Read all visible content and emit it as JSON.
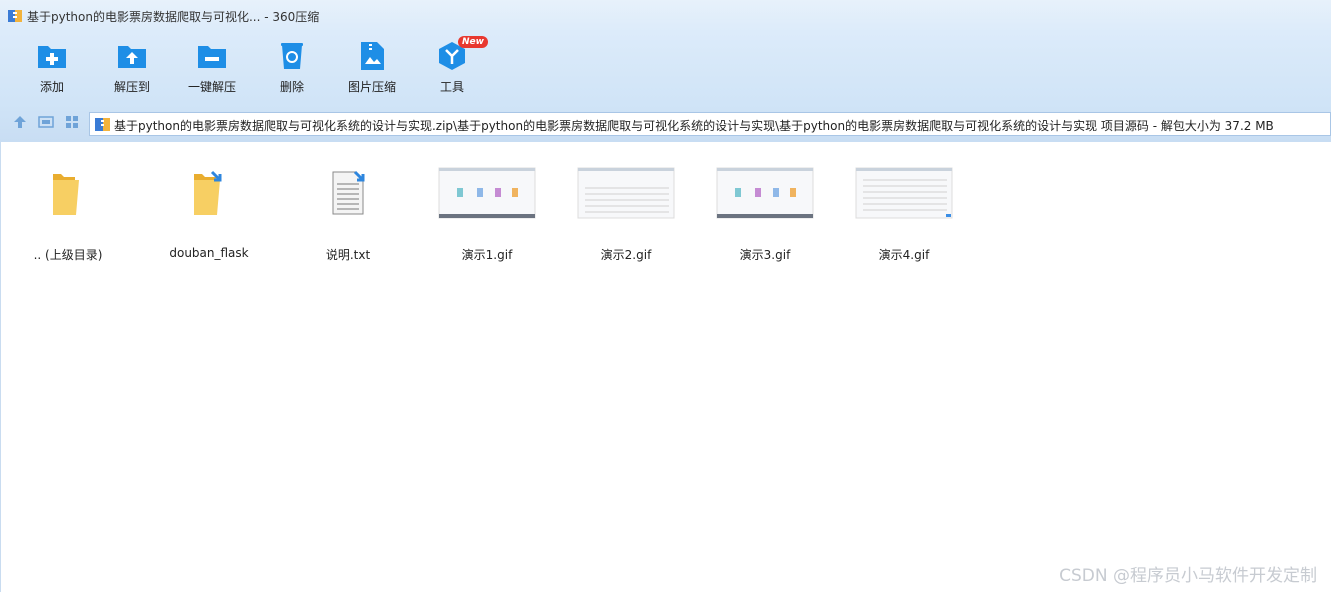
{
  "window": {
    "title": "基于python的电影票房数据爬取与可视化... - 360压缩"
  },
  "toolbar": {
    "items": [
      {
        "label": "添加",
        "icon": "add-icon"
      },
      {
        "label": "解压到",
        "icon": "extract-to-icon"
      },
      {
        "label": "一键解压",
        "icon": "one-click-extract-icon"
      },
      {
        "label": "删除",
        "icon": "delete-icon"
      },
      {
        "label": "图片压缩",
        "icon": "image-compress-icon"
      },
      {
        "label": "工具",
        "icon": "tools-icon",
        "badge": "New"
      }
    ]
  },
  "address": {
    "path": "基于python的电影票房数据爬取与可视化系统的设计与实现.zip\\基于python的电影票房数据爬取与可视化系统的设计与实现\\基于python的电影票房数据爬取与可视化系统的设计与实现 项目源码 - 解包大小为 37.2 MB"
  },
  "files": [
    {
      "name": ".. (上级目录)",
      "icon": "parent-folder-icon"
    },
    {
      "name": "douban_flask",
      "icon": "folder-icon"
    },
    {
      "name": "说明.txt",
      "icon": "text-file-icon"
    },
    {
      "name": "演示1.gif",
      "icon": "gif-thumbnail"
    },
    {
      "name": "演示2.gif",
      "icon": "gif-thumbnail"
    },
    {
      "name": "演示3.gif",
      "icon": "gif-thumbnail"
    },
    {
      "name": "演示4.gif",
      "icon": "gif-thumbnail"
    }
  ],
  "watermark": "CSDN @程序员小马软件开发定制",
  "colors": {
    "accent": "#1e8ee6",
    "toolbar_bg": "#d6e8f9",
    "badge": "#e8382f",
    "folder": "#f5c451"
  }
}
